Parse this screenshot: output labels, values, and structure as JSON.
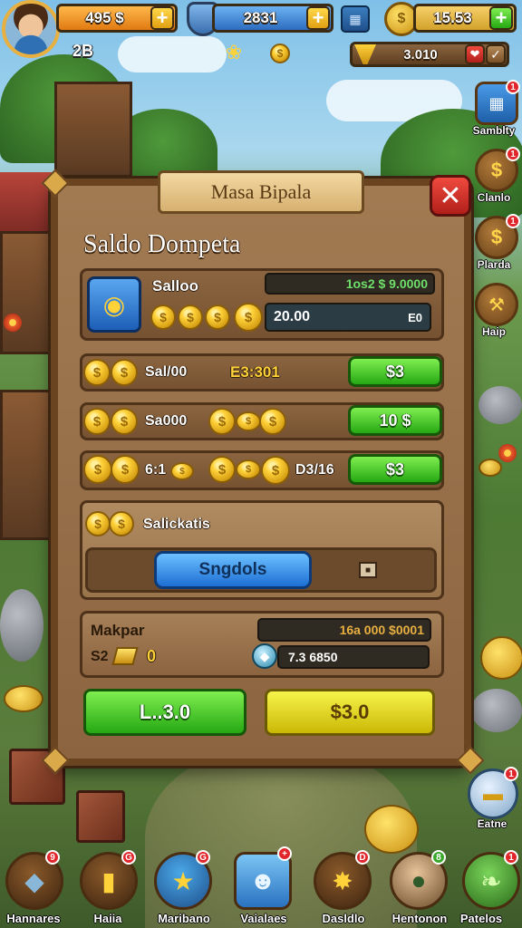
{
  "colors": {
    "currency_orange": "#f39a28",
    "gem_blue": "#3f8ee0",
    "accent_green": "#2eb81a",
    "accent_yellow": "#e8e224",
    "close_red": "#d12a22",
    "panel_brown": "#8c6440"
  },
  "hud": {
    "coins": "495 $",
    "level": "2B",
    "gems": "2831",
    "gold": "15.53",
    "event_value": "3.010"
  },
  "side_menu": [
    {
      "icon": "calendar-icon",
      "label": "Samblty",
      "badge": "1"
    },
    {
      "icon": "dollar-coin-icon",
      "label": "Clanlo",
      "badge": "1"
    },
    {
      "icon": "dollar-coin-icon",
      "label": "Plarda",
      "badge": "1"
    },
    {
      "icon": "hammer-icon",
      "label": "Haip",
      "badge": ""
    },
    {
      "icon": "gold-bars-icon",
      "label": "Eatne",
      "badge": "1"
    }
  ],
  "dialog": {
    "title": "Masa Bipala",
    "heading": "Saldo Dompeta",
    "saldo": {
      "label": "Salloo",
      "target": "1os2 $ 9.0000",
      "value": "20.00",
      "suffix": "E0"
    },
    "offers": [
      {
        "name": "Sal/00",
        "price_text": "E3:301",
        "button": "$3"
      },
      {
        "name": "Sa000",
        "price_text": "",
        "button": "10 $"
      },
      {
        "name": "6:1",
        "price_text": "D3/16",
        "button": "$3"
      }
    ],
    "salicatis": {
      "label": "Salickatis",
      "button": "Sngdols"
    },
    "makpar": {
      "label": "Makpar",
      "bar_value": "16a 000 $0001",
      "amount_label": "S2",
      "amount_value": "0",
      "gem_value": "7.3 6850"
    },
    "buttons": {
      "left": "L..3.0",
      "right": "$3.0"
    }
  },
  "bottom_nav": [
    {
      "icon": "crystal-icon",
      "label": "Hannares",
      "badge": "9"
    },
    {
      "icon": "gold-bar-icon",
      "label": "Haiia",
      "badge": "G"
    },
    {
      "icon": "star-map-icon",
      "label": "Maribano",
      "badge": "G"
    },
    {
      "icon": "blue-creature-icon",
      "label": "Vaialaes",
      "badge": "+"
    },
    {
      "icon": "starburst-icon",
      "label": "Dasldlo",
      "badge": "D"
    },
    {
      "icon": "soldier-icon",
      "label": "Hentonon",
      "badge": "8"
    },
    {
      "icon": "leaf-icon",
      "label": "Patelos",
      "badge": "1"
    }
  ]
}
